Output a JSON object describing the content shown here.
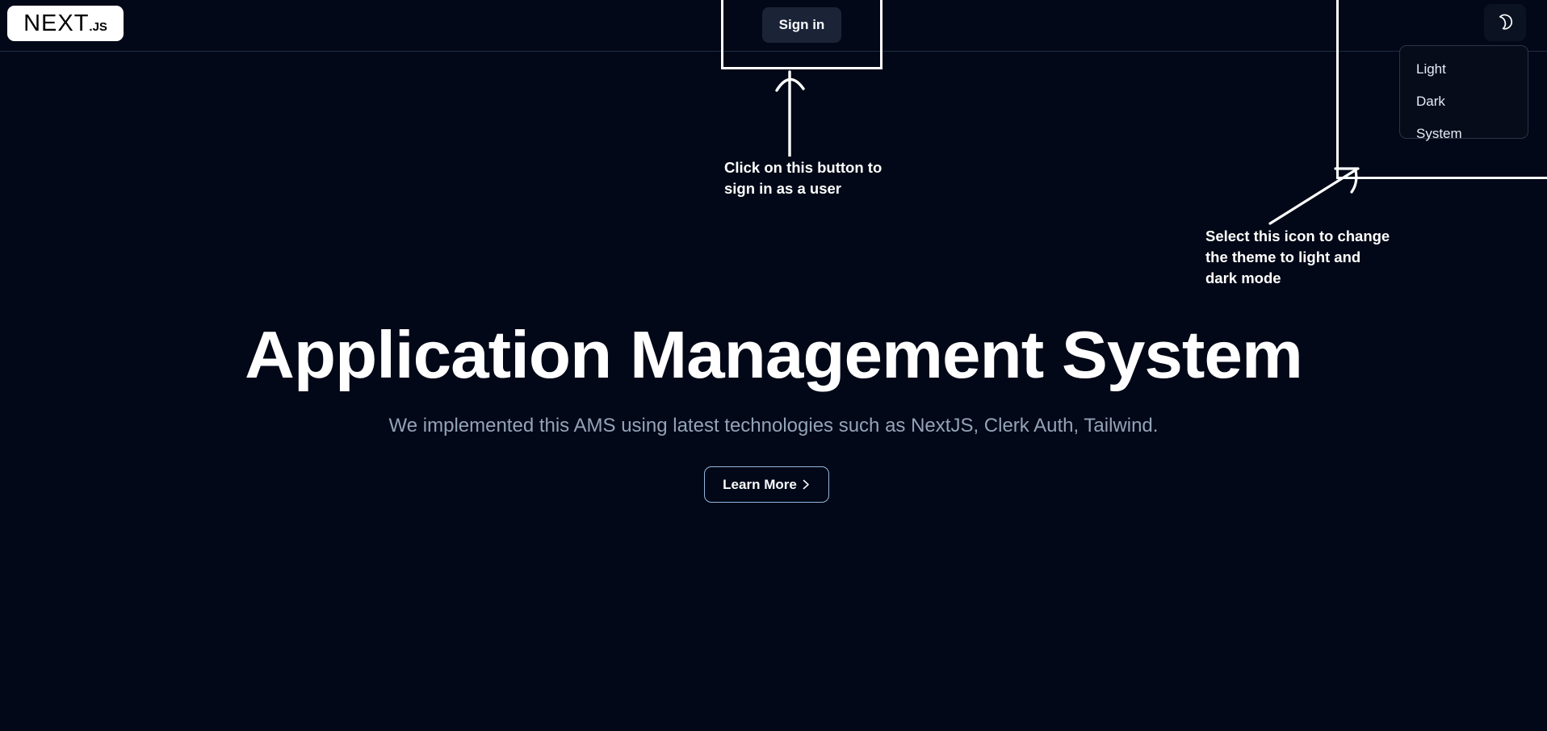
{
  "theme_colors": {
    "background": "#020817",
    "header_border": "#1e2d45",
    "signin_button_bg": "#1b2436",
    "text_primary": "#ffffff",
    "text_muted": "#94a3b8",
    "learn_more_border": "#93b7e0",
    "annotation": "#ffffff"
  },
  "header": {
    "logo": {
      "name": "NEXT",
      "suffix": ".JS"
    },
    "signin_label": "Sign in",
    "theme_toggle_icon": "moon-icon"
  },
  "theme_menu": {
    "items": [
      {
        "label": "Light"
      },
      {
        "label": "Dark"
      },
      {
        "label": "System"
      }
    ]
  },
  "hero": {
    "title": "Application Management System",
    "subtitle": "We implemented this AMS using latest technologies such as NextJS, Clerk Auth, Tailwind.",
    "cta_label": "Learn More",
    "cta_icon": "chevron-right-icon"
  },
  "annotations": {
    "signin": {
      "text": "Click on this button to\nsign in as a user",
      "arrow": "arrow-up-icon"
    },
    "theme": {
      "text": "Select this icon to change\nthe theme to light and\ndark mode",
      "arrow": "arrow-up-right-icon"
    }
  }
}
